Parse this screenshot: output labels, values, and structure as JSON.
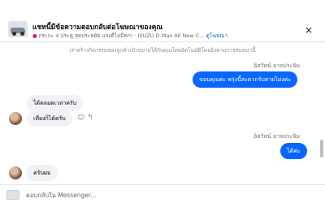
{
  "header": {
    "title": "แชทนี้มีข้อความตอบกลับต่อโฆษณาของคุณ",
    "subtitle_page": "กระบะ 4 ประตู สุดประหยัด แรงดีไม่มีตก!",
    "subtitle_sep": "·",
    "subtitle_ad": "ISUZU D-Max All New C...",
    "subtitle_link": "ดูโฆษณา",
    "close_icon": "×"
  },
  "notice": "เราสร้างกิจกรรมของลูกค้าเป้าหมายให้กับคุณโดยอัตโนมัติโดยอิงตามการสนทนานี้",
  "messages": [
    {
      "type": "outgoing",
      "sender": "อิสวัทน์ อาจประจิม",
      "text": "ขอบคุณค่ะ พรุ่งนี้สะดวกรับสายไม่งค่ะ"
    },
    {
      "type": "incoming",
      "text": "ได้ตลอดเวลาครับ"
    },
    {
      "type": "incoming",
      "text": "เที่ยงก็ได้ครับ",
      "icons": "☺ ↰"
    },
    {
      "type": "outgoing",
      "sender": "อิสวัทน์ อาจประจิม",
      "text": "ได้ค่ะ"
    },
    {
      "type": "incoming",
      "text": "ครับผม"
    }
  ],
  "composer": {
    "placeholder": "ตอบกลับใน Messenger..."
  },
  "colors": {
    "accent": "#0866ff",
    "incoming_bubble": "#f0f2f5",
    "link": "#0064d1"
  },
  "icons": [
    "close-icon",
    "smile-icon",
    "reply-icon",
    "location-pin-icon"
  ]
}
